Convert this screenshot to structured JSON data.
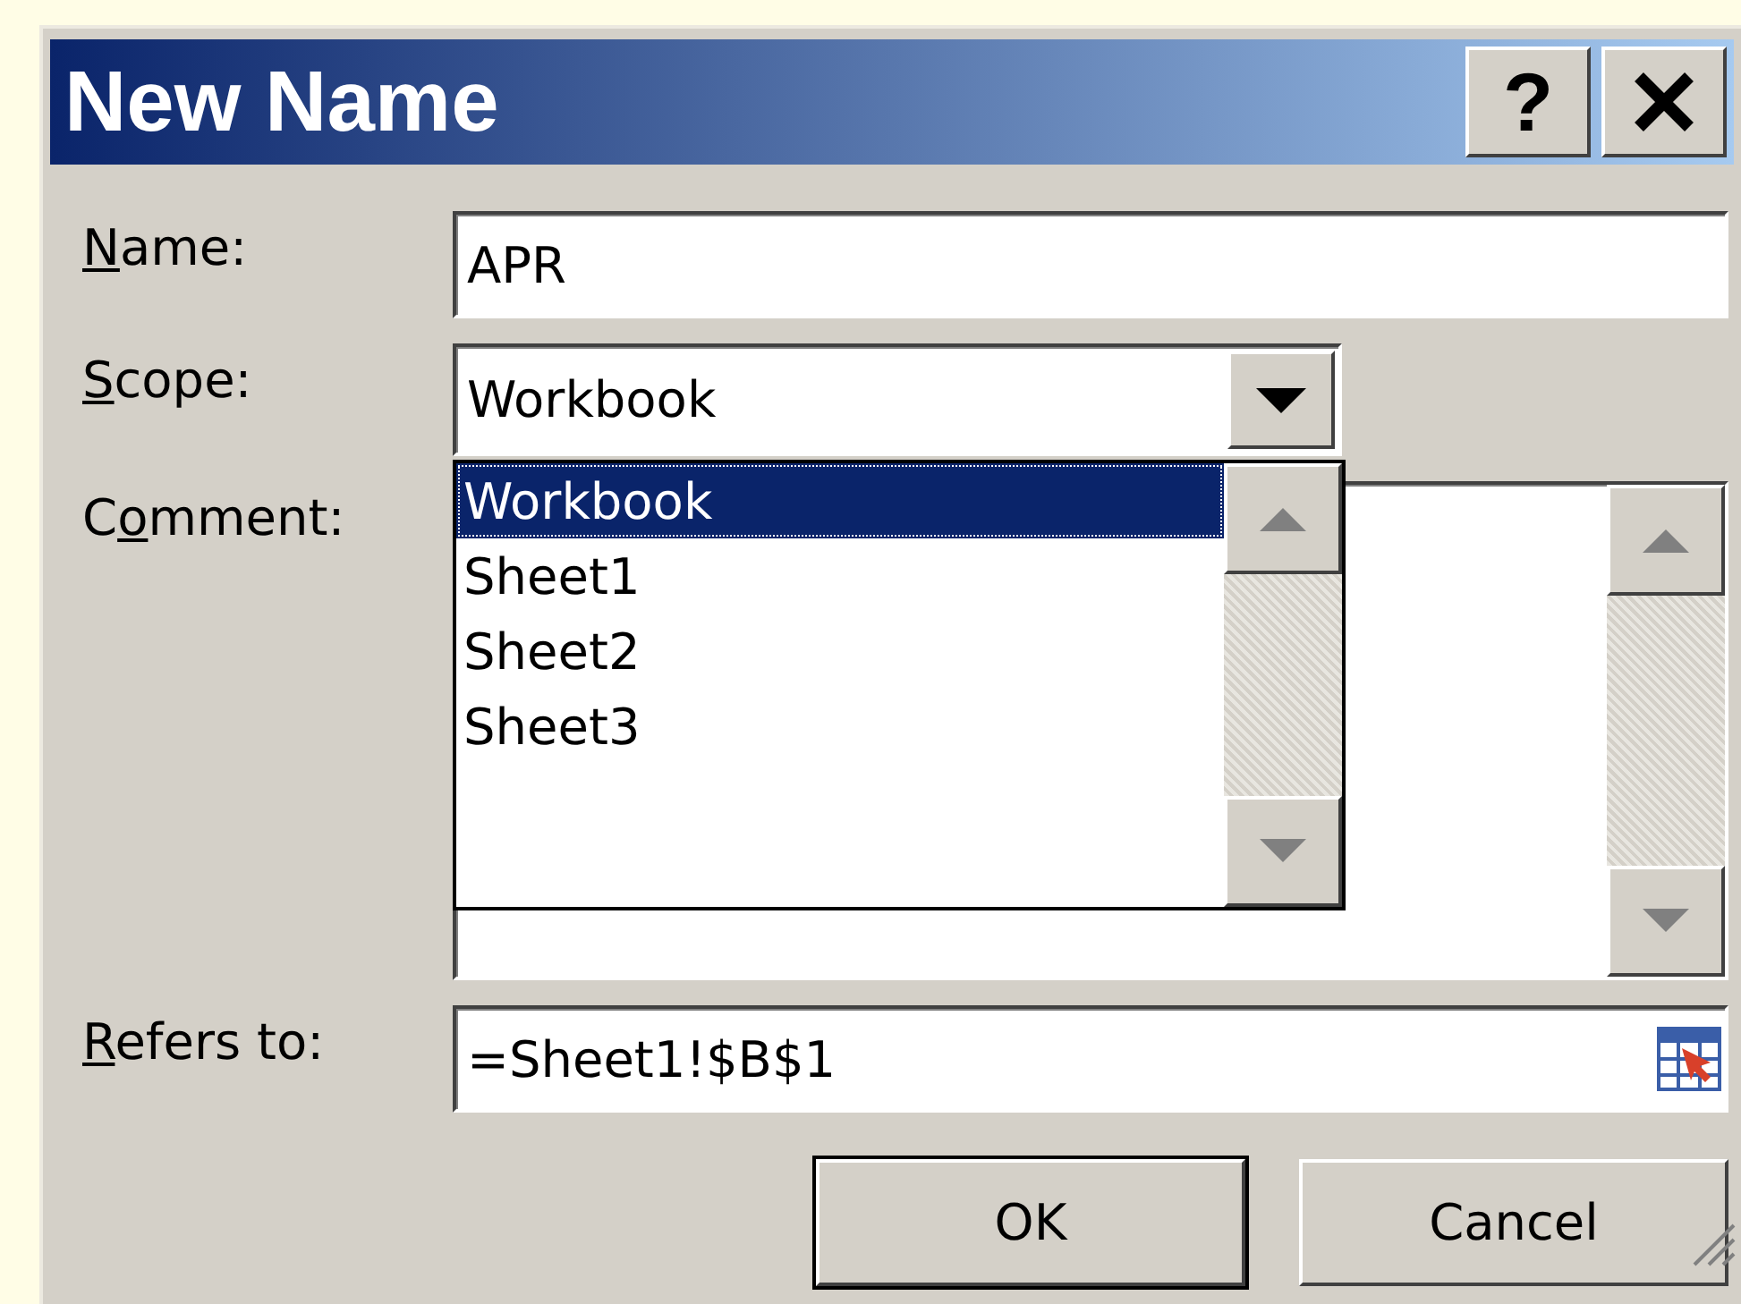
{
  "window": {
    "title": "New Name",
    "help_button": "?"
  },
  "fields": [
    {
      "kind": "text",
      "label": {
        "key": "N",
        "after": "ame:"
      },
      "value": "APR"
    },
    {
      "kind": "dropdown",
      "label": {
        "key": "S",
        "after": "cope:"
      },
      "value": "Workbook",
      "expanded": true,
      "options": [
        {
          "label": "Workbook",
          "selected": true
        },
        {
          "label": "Sheet1",
          "selected": false
        },
        {
          "label": "Sheet2",
          "selected": false
        },
        {
          "label": "Sheet3",
          "selected": false
        }
      ]
    },
    {
      "kind": "textarea",
      "label": {
        "before": "C",
        "key": "o",
        "after": "mment:"
      }
    },
    {
      "kind": "reference",
      "label": {
        "key": "R",
        "after": "efers to:"
      },
      "value": "=Sheet1!$B$1"
    }
  ],
  "buttons": [
    {
      "label": "OK",
      "default": true
    },
    {
      "label": "Cancel",
      "default": false
    }
  ]
}
